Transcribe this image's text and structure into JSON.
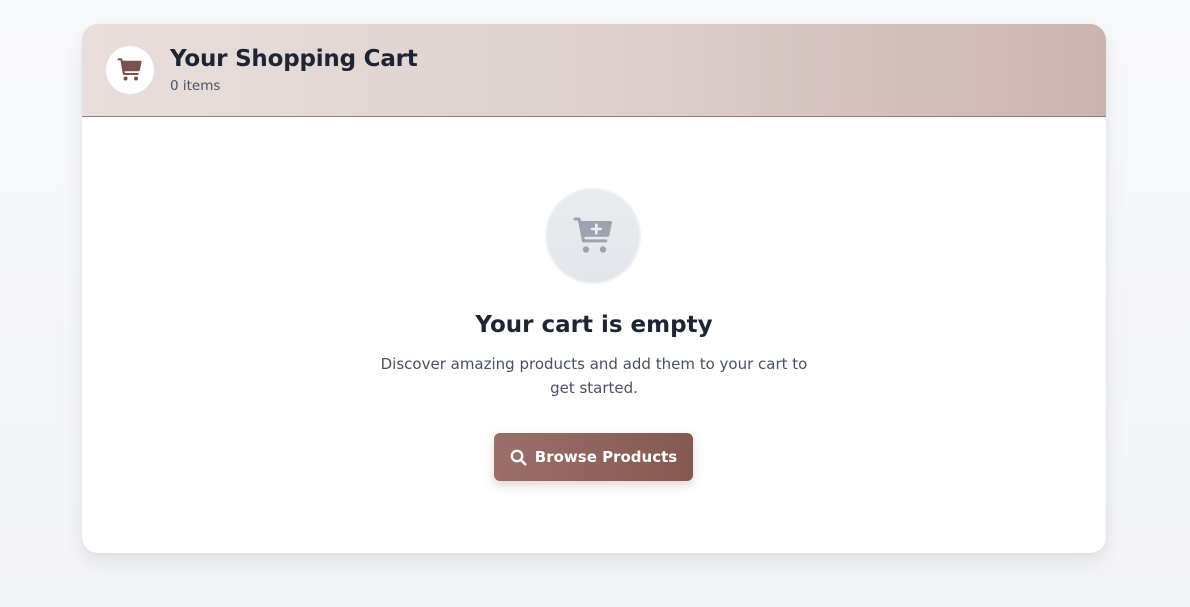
{
  "cart": {
    "title": "Your Shopping Cart",
    "item_count": "0 items"
  },
  "empty_state": {
    "title": "Your cart is empty",
    "description": "Discover amazing products and add them to your cart to get started.",
    "button_label": "Browse Products"
  },
  "icons": {
    "header": "shopping-cart-icon",
    "empty": "cart-plus-icon",
    "button": "search-icon"
  },
  "colors": {
    "accent": "#865852",
    "header_gradient_start": "#e8dfdc",
    "header_gradient_end": "#cbb4b0",
    "empty_icon": "#9ca3af"
  }
}
